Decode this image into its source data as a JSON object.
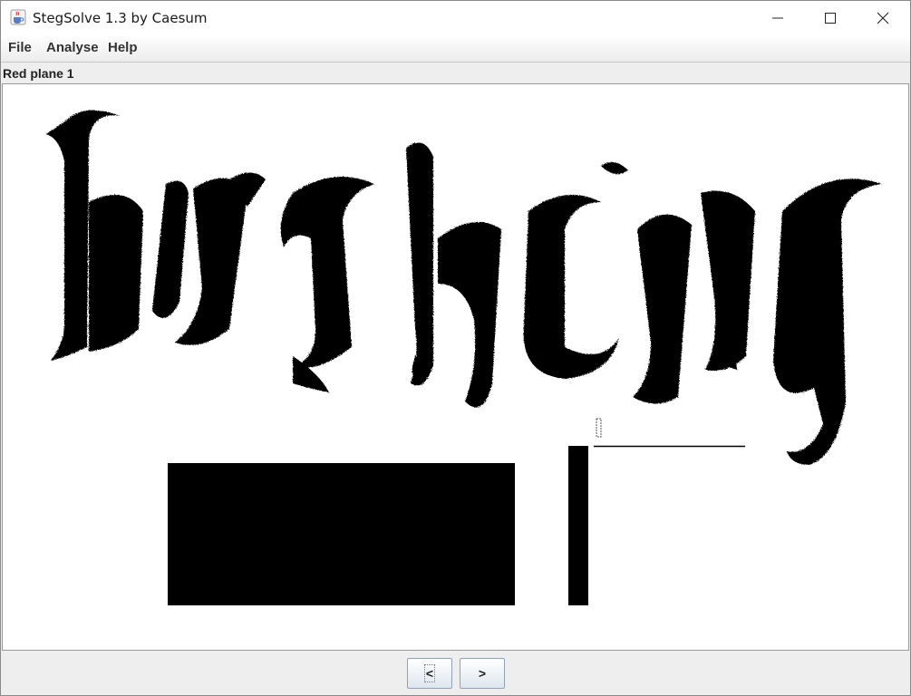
{
  "window": {
    "title": "StegSolve 1.3 by Caesum",
    "app_icon": "java-cup-icon"
  },
  "menu": {
    "items": [
      "File",
      "Analyse",
      "Help"
    ]
  },
  "view": {
    "plane_label": "Red plane 1"
  },
  "nav": {
    "prev_label": "<",
    "next_label": ">"
  },
  "colors": {
    "foreground": "#000000",
    "background": "#ffffff",
    "chrome": "#eeeeee"
  }
}
